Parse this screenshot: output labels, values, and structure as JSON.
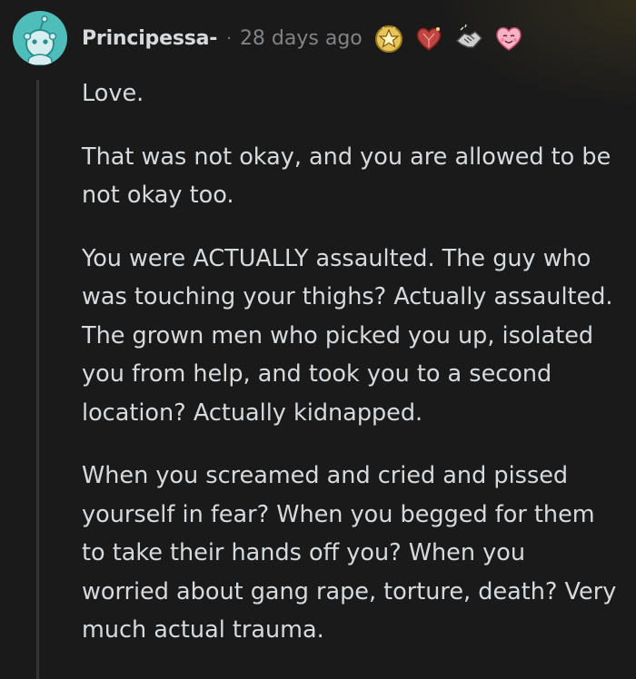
{
  "comment": {
    "username": "Principessa-",
    "separator": "·",
    "timestamp": "28 days ago",
    "awards": [
      "gold-star-award-icon",
      "heart-gem-award-icon",
      "handshake-award-icon",
      "wholesome-award-icon"
    ],
    "paragraphs": [
      "Love.",
      "That was not okay, and you are allowed to be not okay too.",
      "You were ACTUALLY assaulted. The guy who was touching your thighs? Actually assaulted. The grown men who picked you up, isolated you from help, and took you to a second location? Actually kidnapped.",
      "When you screamed and cried and pissed yourself in fear? When you begged for them to take their hands off you? When you worried about gang rape, torture, death? Very much actual trauma."
    ]
  },
  "colors": {
    "background": "#1a1a1b",
    "text": "#d7dadc",
    "meta": "#818384",
    "avatar": "#4fbdba",
    "thread_line": "#343536"
  }
}
